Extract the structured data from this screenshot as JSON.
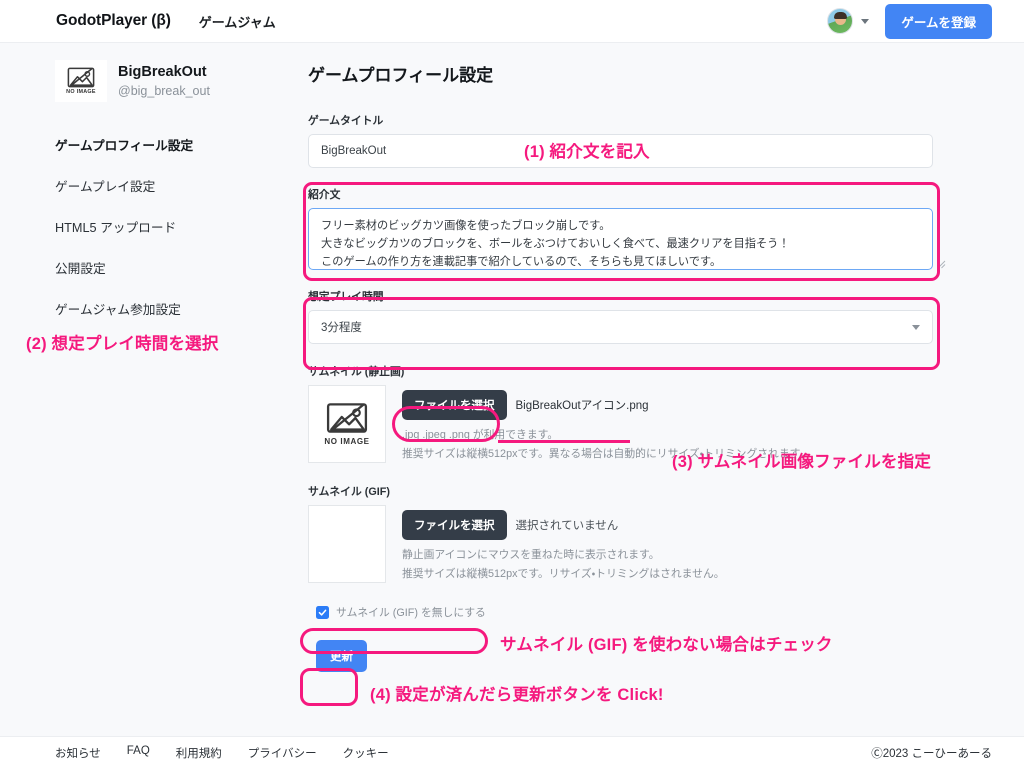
{
  "header": {
    "brand": "GodotPlayer (β)",
    "nav_link": "ゲームジャム",
    "avatar_name": "user-avatar",
    "register_button": "ゲームを登録",
    "accent_blue": "#4285f4"
  },
  "sidebar": {
    "game": {
      "thumb_placeholder": "NO IMAGE",
      "name": "BigBreakOut",
      "handle": "@big_break_out"
    },
    "items": [
      {
        "label": "ゲームプロフィール設定",
        "active": true
      },
      {
        "label": "ゲームプレイ設定",
        "active": false
      },
      {
        "label": "HTML5 アップロード",
        "active": false
      },
      {
        "label": "公開設定",
        "active": false
      },
      {
        "label": "ゲームジャム参加設定",
        "active": false
      }
    ]
  },
  "main": {
    "page_title": "ゲームプロフィール設定",
    "game_title": {
      "label": "ゲームタイトル",
      "value": "BigBreakOut",
      "placeholder": "ゲームタイトル"
    },
    "description": {
      "label": "紹介文",
      "value": "フリー素材のビッグカツ画像を使ったブロック崩しです。\n大きなビッグカツのブロックを、ボールをぶつけておいしく食べて、最速クリアを目指そう！\nこのゲームの作り方を連載記事で紹介しているので、そちらも見てほしいです。",
      "placeholder": "紹介文"
    },
    "playtime": {
      "label": "想定プレイ時間",
      "value": "3分程度"
    },
    "thumbnail_static": {
      "label": "サムネイル (静止画)",
      "placeholder_text": "NO IMAGE",
      "file_button": "ファイルを選択",
      "file_name": "BigBreakOutアイコン.png",
      "hint_line1": ".jpg .jpeg .png が利用できます。",
      "hint_line2": "推奨サイズは縦横512pxです。異なる場合は自動的にリサイズ・トリミングされます。"
    },
    "thumbnail_gif": {
      "label": "サムネイル (GIF)",
      "file_button": "ファイルを選択",
      "file_name": "選択されていません",
      "hint_line1": "静止画アイコンにマウスを重ねた時に表示されます。",
      "hint_line2": "推奨サイズは縦横512pxです。リサイズ・トリミングはされません。"
    },
    "gif_disable": {
      "label": "サムネイル (GIF) を無しにする",
      "checked": true
    },
    "update_button": "更新"
  },
  "annotations": {
    "accent_pink": "#f5197e",
    "step1": "(1) 紹介文を記入",
    "step2": "(2) 想定プレイ時間を選択",
    "step3": "(3) サムネイル画像ファイルを指定",
    "step_gif": "サムネイル (GIF) を使わない場合はチェック",
    "step4": "(4) 設定が済んだら更新ボタンを Click!"
  },
  "footer": {
    "links": [
      "お知らせ",
      "FAQ",
      "利用規約",
      "プライバシー",
      "クッキー"
    ],
    "copyright": "Ⓒ2023 こーひーあーる"
  }
}
